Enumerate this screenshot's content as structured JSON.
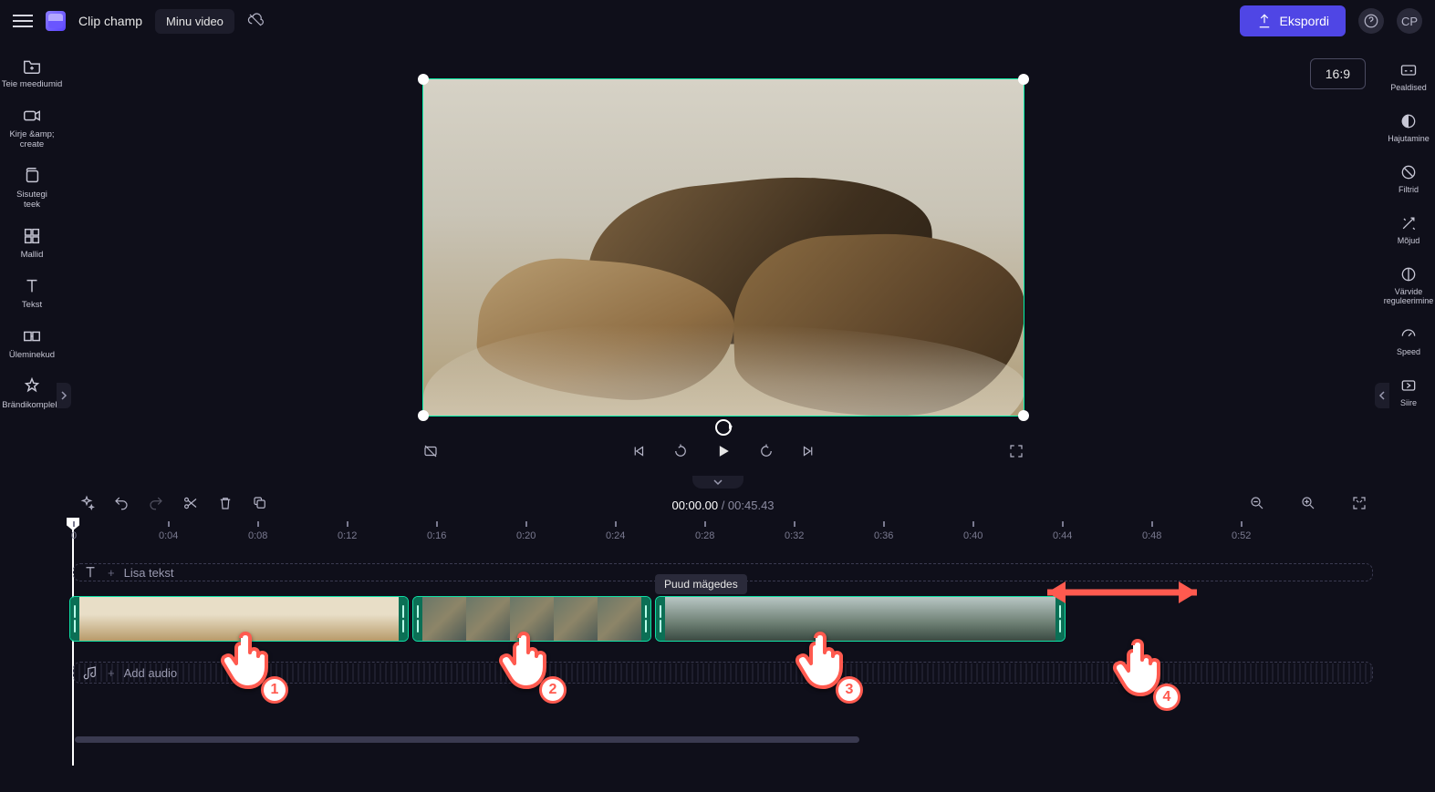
{
  "header": {
    "brand": "Clip champ",
    "project_title": "Minu video",
    "export_label": "Ekspordi",
    "avatar_initials": "CP",
    "aspect_label": "16:9"
  },
  "left_sidebar": {
    "items": [
      {
        "label": "Teie meediumid"
      },
      {
        "label": "Kirje &amp;\ncreate"
      },
      {
        "label": "Sisutegi\nteek"
      },
      {
        "label": "Mallid"
      },
      {
        "label": "Tekst"
      },
      {
        "label": "Üleminekud"
      },
      {
        "label": "Brändikomplekt"
      }
    ]
  },
  "right_sidebar": {
    "items": [
      {
        "label": "Pealdised"
      },
      {
        "label": "Hajutamine"
      },
      {
        "label": "Filtrid"
      },
      {
        "label": "Mõjud"
      },
      {
        "label": "Värvide\nreguleerimine"
      },
      {
        "label": "Speed"
      },
      {
        "label": "Siire"
      }
    ]
  },
  "player": {
    "time_current": "00:00.00",
    "time_total": "00:45.43"
  },
  "ruler_ticks": [
    "0",
    "0:04",
    "0:08",
    "0:12",
    "0:16",
    "0:20",
    "0:24",
    "0:28",
    "0:32",
    "0:36",
    "0:40",
    "0:44",
    "0:48",
    "0:52"
  ],
  "tracks": {
    "text_hint": "Lisa tekst",
    "audio_hint": "Add audio",
    "tooltip_clip3": "Puud mägedes"
  },
  "annotation_badges": [
    "1",
    "2",
    "3",
    "4"
  ]
}
